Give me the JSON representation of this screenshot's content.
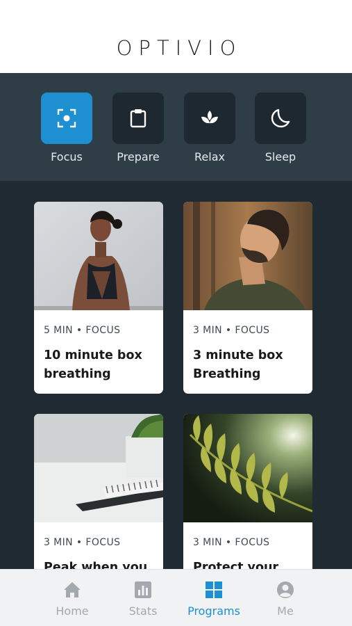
{
  "header": {
    "logo": "OPTIVIO"
  },
  "categories": [
    {
      "label": "Focus",
      "icon": "focus-icon",
      "active": true
    },
    {
      "label": "Prepare",
      "icon": "clipboard-icon",
      "active": false
    },
    {
      "label": "Relax",
      "icon": "lotus-icon",
      "active": false
    },
    {
      "label": "Sleep",
      "icon": "moon-icon",
      "active": false
    }
  ],
  "cards": [
    {
      "meta": "5 MIN • FOCUS",
      "title": "10 minute box breathing"
    },
    {
      "meta": "3 MIN • FOCUS",
      "title": "3 minute box Breathing"
    },
    {
      "meta": "3 MIN • FOCUS",
      "title": "Peak when you"
    },
    {
      "meta": "3 MIN • FOCUS",
      "title": "Protect your"
    }
  ],
  "tabs": [
    {
      "label": "Home",
      "icon": "home-icon",
      "active": false
    },
    {
      "label": "Stats",
      "icon": "stats-icon",
      "active": false
    },
    {
      "label": "Programs",
      "icon": "grid-icon",
      "active": true
    },
    {
      "label": "Me",
      "icon": "person-icon",
      "active": false
    }
  ],
  "colors": {
    "accent": "#1e8fd1",
    "dark_bg": "#1f2a33",
    "category_bar": "#2f3d47",
    "tile": "#1e2830"
  }
}
